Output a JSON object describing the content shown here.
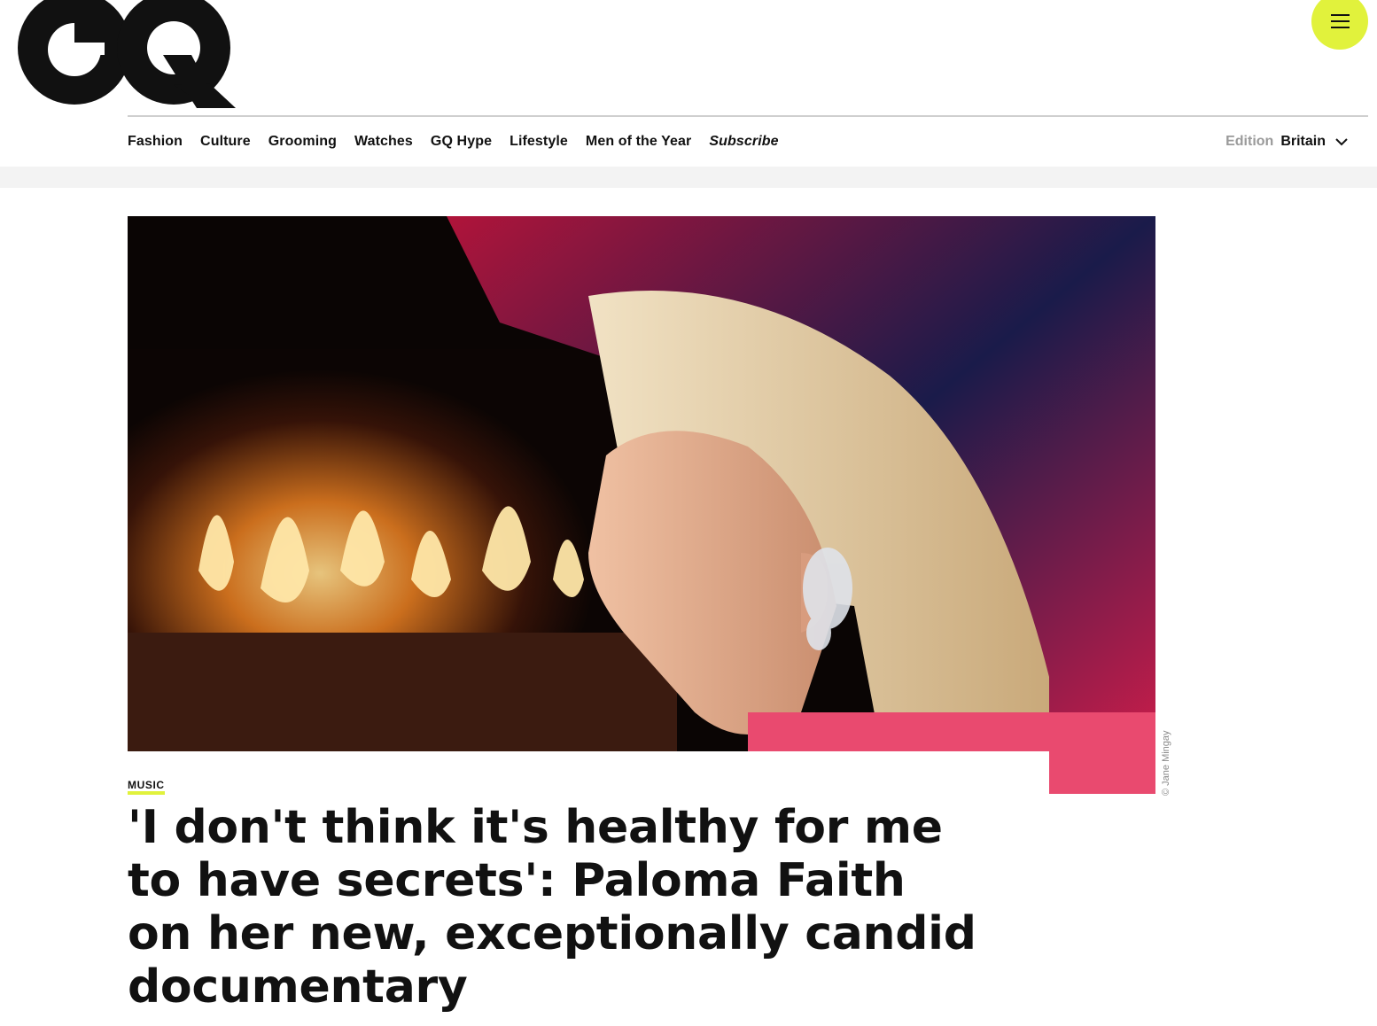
{
  "brand": {
    "logo_text": "GQ",
    "accent_color": "#e1f23c"
  },
  "header": {
    "menu_icon": "hamburger-icon"
  },
  "nav": {
    "items": [
      {
        "label": "Fashion"
      },
      {
        "label": "Culture"
      },
      {
        "label": "Grooming"
      },
      {
        "label": "Watches"
      },
      {
        "label": "GQ Hype"
      },
      {
        "label": "Lifestyle"
      },
      {
        "label": "Men of the Year"
      },
      {
        "label": "Subscribe"
      }
    ],
    "edition_label": "Edition",
    "edition_value": "Britain",
    "edition_icon": "chevron-down-icon"
  },
  "article": {
    "photo_credit": "© Jane Mingay",
    "rubric": "MUSIC",
    "headline": "'I don't think it's healthy for me to have secrets': Paloma Faith on her new, exceptionally candid documentary"
  }
}
